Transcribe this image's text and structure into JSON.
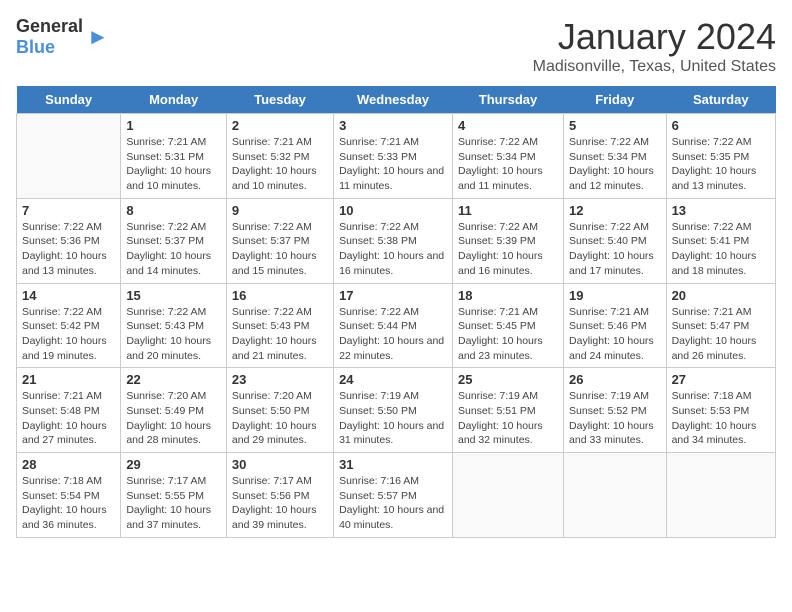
{
  "logo": {
    "general": "General",
    "blue": "Blue"
  },
  "title": "January 2024",
  "subtitle": "Madisonville, Texas, United States",
  "headers": [
    "Sunday",
    "Monday",
    "Tuesday",
    "Wednesday",
    "Thursday",
    "Friday",
    "Saturday"
  ],
  "weeks": [
    [
      {
        "day": "",
        "sunrise": "",
        "sunset": "",
        "daylight": ""
      },
      {
        "day": "1",
        "sunrise": "Sunrise: 7:21 AM",
        "sunset": "Sunset: 5:31 PM",
        "daylight": "Daylight: 10 hours and 10 minutes."
      },
      {
        "day": "2",
        "sunrise": "Sunrise: 7:21 AM",
        "sunset": "Sunset: 5:32 PM",
        "daylight": "Daylight: 10 hours and 10 minutes."
      },
      {
        "day": "3",
        "sunrise": "Sunrise: 7:21 AM",
        "sunset": "Sunset: 5:33 PM",
        "daylight": "Daylight: 10 hours and 11 minutes."
      },
      {
        "day": "4",
        "sunrise": "Sunrise: 7:22 AM",
        "sunset": "Sunset: 5:34 PM",
        "daylight": "Daylight: 10 hours and 11 minutes."
      },
      {
        "day": "5",
        "sunrise": "Sunrise: 7:22 AM",
        "sunset": "Sunset: 5:34 PM",
        "daylight": "Daylight: 10 hours and 12 minutes."
      },
      {
        "day": "6",
        "sunrise": "Sunrise: 7:22 AM",
        "sunset": "Sunset: 5:35 PM",
        "daylight": "Daylight: 10 hours and 13 minutes."
      }
    ],
    [
      {
        "day": "7",
        "sunrise": "Sunrise: 7:22 AM",
        "sunset": "Sunset: 5:36 PM",
        "daylight": "Daylight: 10 hours and 13 minutes."
      },
      {
        "day": "8",
        "sunrise": "Sunrise: 7:22 AM",
        "sunset": "Sunset: 5:37 PM",
        "daylight": "Daylight: 10 hours and 14 minutes."
      },
      {
        "day": "9",
        "sunrise": "Sunrise: 7:22 AM",
        "sunset": "Sunset: 5:37 PM",
        "daylight": "Daylight: 10 hours and 15 minutes."
      },
      {
        "day": "10",
        "sunrise": "Sunrise: 7:22 AM",
        "sunset": "Sunset: 5:38 PM",
        "daylight": "Daylight: 10 hours and 16 minutes."
      },
      {
        "day": "11",
        "sunrise": "Sunrise: 7:22 AM",
        "sunset": "Sunset: 5:39 PM",
        "daylight": "Daylight: 10 hours and 16 minutes."
      },
      {
        "day": "12",
        "sunrise": "Sunrise: 7:22 AM",
        "sunset": "Sunset: 5:40 PM",
        "daylight": "Daylight: 10 hours and 17 minutes."
      },
      {
        "day": "13",
        "sunrise": "Sunrise: 7:22 AM",
        "sunset": "Sunset: 5:41 PM",
        "daylight": "Daylight: 10 hours and 18 minutes."
      }
    ],
    [
      {
        "day": "14",
        "sunrise": "Sunrise: 7:22 AM",
        "sunset": "Sunset: 5:42 PM",
        "daylight": "Daylight: 10 hours and 19 minutes."
      },
      {
        "day": "15",
        "sunrise": "Sunrise: 7:22 AM",
        "sunset": "Sunset: 5:43 PM",
        "daylight": "Daylight: 10 hours and 20 minutes."
      },
      {
        "day": "16",
        "sunrise": "Sunrise: 7:22 AM",
        "sunset": "Sunset: 5:43 PM",
        "daylight": "Daylight: 10 hours and 21 minutes."
      },
      {
        "day": "17",
        "sunrise": "Sunrise: 7:22 AM",
        "sunset": "Sunset: 5:44 PM",
        "daylight": "Daylight: 10 hours and 22 minutes."
      },
      {
        "day": "18",
        "sunrise": "Sunrise: 7:21 AM",
        "sunset": "Sunset: 5:45 PM",
        "daylight": "Daylight: 10 hours and 23 minutes."
      },
      {
        "day": "19",
        "sunrise": "Sunrise: 7:21 AM",
        "sunset": "Sunset: 5:46 PM",
        "daylight": "Daylight: 10 hours and 24 minutes."
      },
      {
        "day": "20",
        "sunrise": "Sunrise: 7:21 AM",
        "sunset": "Sunset: 5:47 PM",
        "daylight": "Daylight: 10 hours and 26 minutes."
      }
    ],
    [
      {
        "day": "21",
        "sunrise": "Sunrise: 7:21 AM",
        "sunset": "Sunset: 5:48 PM",
        "daylight": "Daylight: 10 hours and 27 minutes."
      },
      {
        "day": "22",
        "sunrise": "Sunrise: 7:20 AM",
        "sunset": "Sunset: 5:49 PM",
        "daylight": "Daylight: 10 hours and 28 minutes."
      },
      {
        "day": "23",
        "sunrise": "Sunrise: 7:20 AM",
        "sunset": "Sunset: 5:50 PM",
        "daylight": "Daylight: 10 hours and 29 minutes."
      },
      {
        "day": "24",
        "sunrise": "Sunrise: 7:19 AM",
        "sunset": "Sunset: 5:50 PM",
        "daylight": "Daylight: 10 hours and 31 minutes."
      },
      {
        "day": "25",
        "sunrise": "Sunrise: 7:19 AM",
        "sunset": "Sunset: 5:51 PM",
        "daylight": "Daylight: 10 hours and 32 minutes."
      },
      {
        "day": "26",
        "sunrise": "Sunrise: 7:19 AM",
        "sunset": "Sunset: 5:52 PM",
        "daylight": "Daylight: 10 hours and 33 minutes."
      },
      {
        "day": "27",
        "sunrise": "Sunrise: 7:18 AM",
        "sunset": "Sunset: 5:53 PM",
        "daylight": "Daylight: 10 hours and 34 minutes."
      }
    ],
    [
      {
        "day": "28",
        "sunrise": "Sunrise: 7:18 AM",
        "sunset": "Sunset: 5:54 PM",
        "daylight": "Daylight: 10 hours and 36 minutes."
      },
      {
        "day": "29",
        "sunrise": "Sunrise: 7:17 AM",
        "sunset": "Sunset: 5:55 PM",
        "daylight": "Daylight: 10 hours and 37 minutes."
      },
      {
        "day": "30",
        "sunrise": "Sunrise: 7:17 AM",
        "sunset": "Sunset: 5:56 PM",
        "daylight": "Daylight: 10 hours and 39 minutes."
      },
      {
        "day": "31",
        "sunrise": "Sunrise: 7:16 AM",
        "sunset": "Sunset: 5:57 PM",
        "daylight": "Daylight: 10 hours and 40 minutes."
      },
      {
        "day": "",
        "sunrise": "",
        "sunset": "",
        "daylight": ""
      },
      {
        "day": "",
        "sunrise": "",
        "sunset": "",
        "daylight": ""
      },
      {
        "day": "",
        "sunrise": "",
        "sunset": "",
        "daylight": ""
      }
    ]
  ]
}
